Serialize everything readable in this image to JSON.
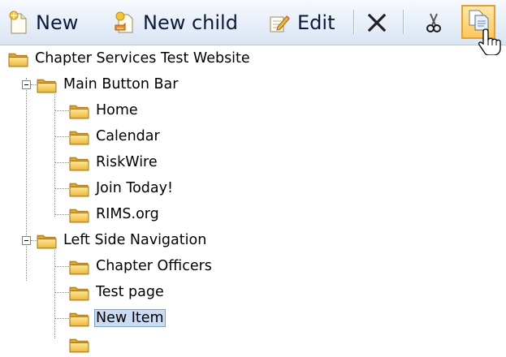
{
  "toolbar": {
    "new_label": "New",
    "new_child_label": "New child",
    "edit_label": "Edit"
  },
  "tree": {
    "root": {
      "label": "Chapter Services Test Website",
      "icon": "folder-icon"
    },
    "groups": [
      {
        "label": "Main Button Bar",
        "expanded": true,
        "children": [
          "Home",
          "Calendar",
          "RiskWire",
          "Join Today!",
          "RIMS.org"
        ]
      },
      {
        "label": "Left Side Navigation",
        "expanded": true,
        "children": [
          "Chapter Officers",
          "Test page",
          "New Item"
        ]
      }
    ],
    "selected": "New Item"
  },
  "colors": {
    "toolbar_top": "#f7fafe",
    "toolbar_bottom": "#d9e5f3",
    "selection_bg": "#c9dcf3",
    "selection_border": "#7ea3d1",
    "folder": "#f3c64a",
    "active_button": "#ffc85a"
  }
}
